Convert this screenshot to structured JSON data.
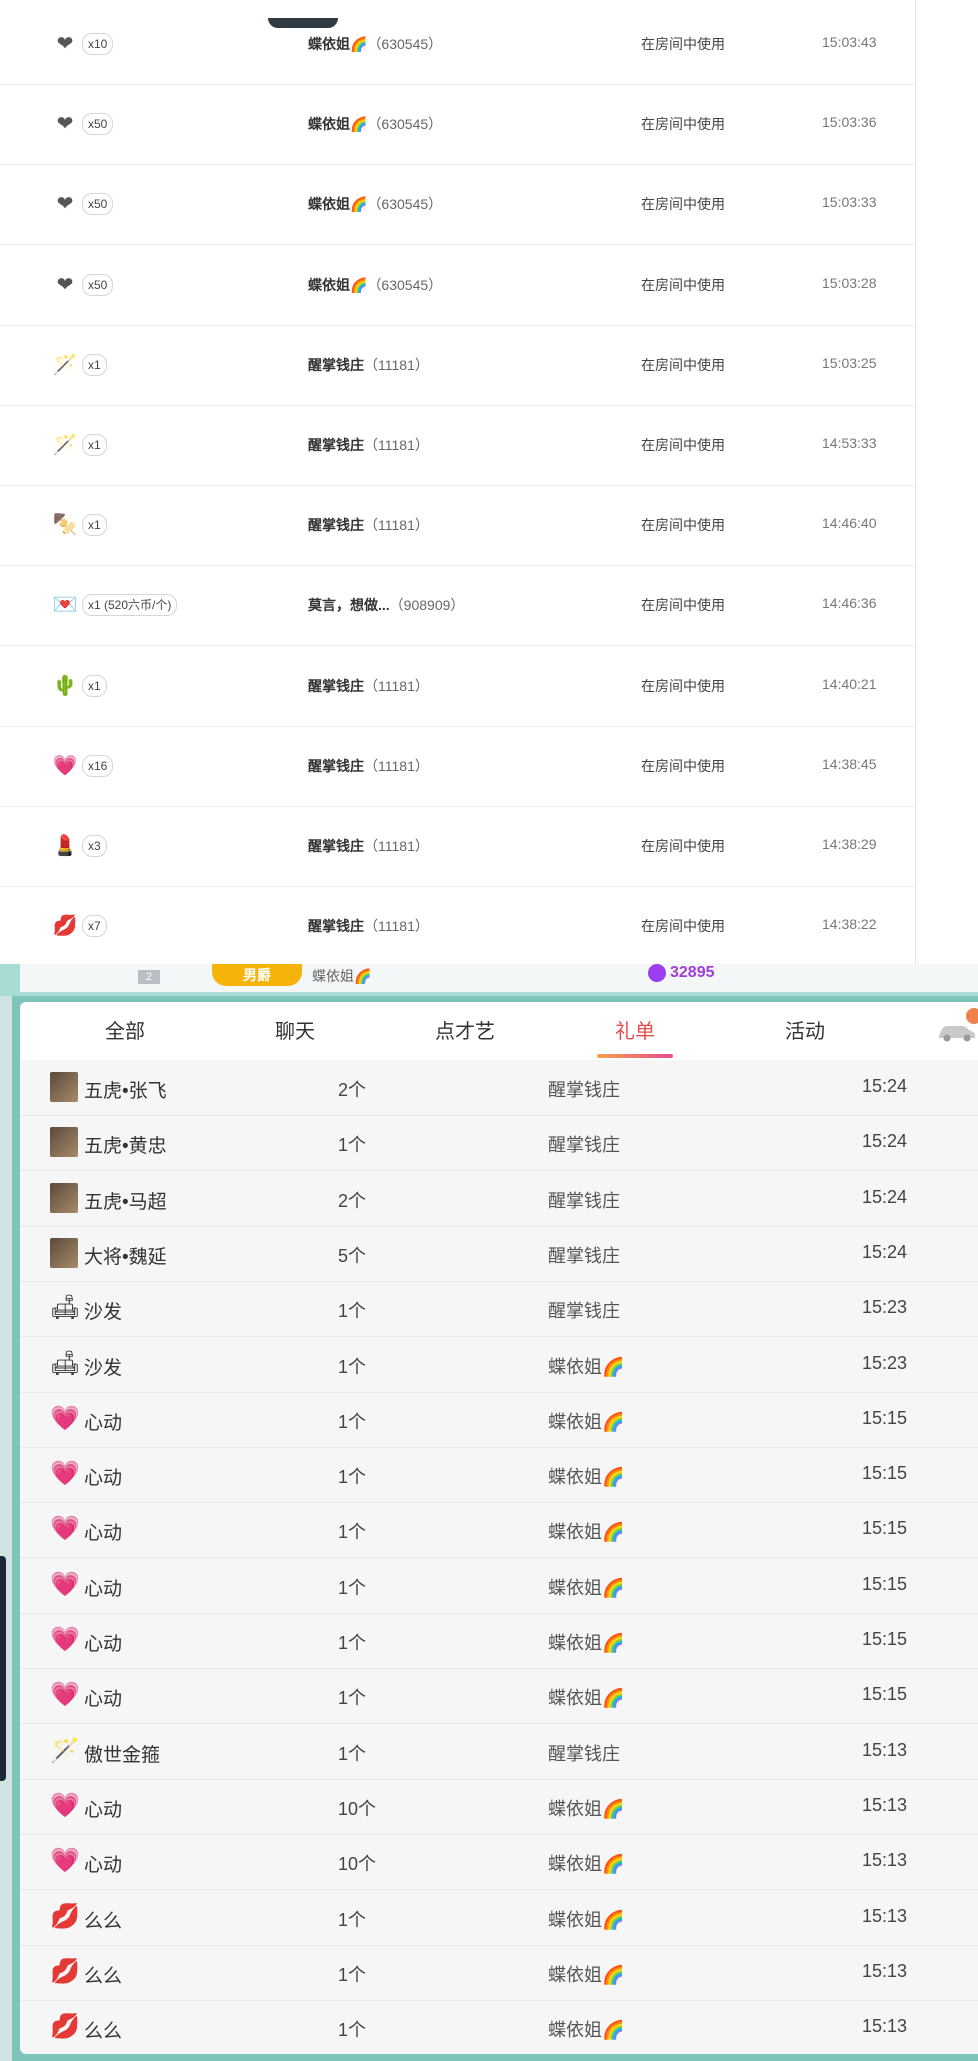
{
  "top_list": {
    "rows": [
      {
        "icon": "❤",
        "icon_name": "red-heart-icon",
        "qty": "x10",
        "user": "蝶依姐🌈",
        "uid": "（630545）",
        "action": "在房间中使用",
        "time": "15:03:43"
      },
      {
        "icon": "❤",
        "icon_name": "red-heart-icon",
        "qty": "x50",
        "user": "蝶依姐🌈",
        "uid": "（630545）",
        "action": "在房间中使用",
        "time": "15:03:36"
      },
      {
        "icon": "❤",
        "icon_name": "red-heart-icon",
        "qty": "x50",
        "user": "蝶依姐🌈",
        "uid": "（630545）",
        "action": "在房间中使用",
        "time": "15:03:33"
      },
      {
        "icon": "❤",
        "icon_name": "red-heart-icon",
        "qty": "x50",
        "user": "蝶依姐🌈",
        "uid": "（630545）",
        "action": "在房间中使用",
        "time": "15:03:28"
      },
      {
        "icon": "🪄",
        "icon_name": "golden-staff-icon",
        "qty": "x1",
        "user": "醒掌钱庄",
        "uid": "（11181）",
        "action": "在房间中使用",
        "time": "15:03:25"
      },
      {
        "icon": "🪄",
        "icon_name": "golden-staff-icon",
        "qty": "x1",
        "user": "醒掌钱庄",
        "uid": "（11181）",
        "action": "在房间中使用",
        "time": "14:53:33"
      },
      {
        "icon": "🍢",
        "icon_name": "skewer-icon",
        "qty": "x1",
        "user": "醒掌钱庄",
        "uid": "（11181）",
        "action": "在房间中使用",
        "time": "14:46:40"
      },
      {
        "icon": "💌",
        "icon_name": "love-letter-icon",
        "qty": "x1 (520六币/个)",
        "user": "莫言，想做...",
        "uid": "（908909）",
        "action": "在房间中使用",
        "time": "14:46:36"
      },
      {
        "icon": "🌵",
        "icon_name": "cactus-icon",
        "qty": "x1",
        "user": "醒掌钱庄",
        "uid": "（11181）",
        "action": "在房间中使用",
        "time": "14:40:21"
      },
      {
        "icon": "💗",
        "icon_name": "heartbeat-icon",
        "qty": "x16",
        "user": "醒掌钱庄",
        "uid": "（11181）",
        "action": "在房间中使用",
        "time": "14:38:45"
      },
      {
        "icon": "💄",
        "icon_name": "lipstick-icon",
        "qty": "x3",
        "user": "醒掌钱庄",
        "uid": "（11181）",
        "action": "在房间中使用",
        "time": "14:38:29"
      },
      {
        "icon": "💋",
        "icon_name": "kiss-lips-icon",
        "qty": "x7",
        "user": "醒掌钱庄",
        "uid": "（11181）",
        "action": "在房间中使用",
        "time": "14:38:22"
      }
    ]
  },
  "rank_strip": {
    "rank": "2",
    "badge": "男爵",
    "name": "蝶依姐🌈",
    "score": "32895"
  },
  "tabs": [
    {
      "label": "全部"
    },
    {
      "label": "聊天"
    },
    {
      "label": "点才艺"
    },
    {
      "label": "礼单",
      "active": true
    },
    {
      "label": "活动"
    }
  ],
  "gift_list": {
    "rows": [
      {
        "icon": "",
        "icon_name": "general-zhangfei-portrait-icon",
        "portrait": true,
        "name": "五虎•张飞",
        "qty": "2个",
        "sender": "醒掌钱庄",
        "time": "15:24"
      },
      {
        "icon": "",
        "icon_name": "general-huangzhong-portrait-icon",
        "portrait": true,
        "name": "五虎•黄忠",
        "qty": "1个",
        "sender": "醒掌钱庄",
        "time": "15:24"
      },
      {
        "icon": "",
        "icon_name": "general-machao-portrait-icon",
        "portrait": true,
        "name": "五虎•马超",
        "qty": "2个",
        "sender": "醒掌钱庄",
        "time": "15:24"
      },
      {
        "icon": "",
        "icon_name": "general-weiyan-portrait-icon",
        "portrait": true,
        "name": "大将•魏延",
        "qty": "5个",
        "sender": "醒掌钱庄",
        "time": "15:24"
      },
      {
        "icon": "🛋",
        "icon_name": "sofa-icon",
        "name": "沙发",
        "qty": "1个",
        "sender": "醒掌钱庄",
        "time": "15:23"
      },
      {
        "icon": "🛋",
        "icon_name": "sofa-icon",
        "name": "沙发",
        "qty": "1个",
        "sender": "蝶依姐🌈",
        "time": "15:23"
      },
      {
        "icon": "💗",
        "icon_name": "heartbeat-icon",
        "name": "心动",
        "qty": "1个",
        "sender": "蝶依姐🌈",
        "time": "15:15"
      },
      {
        "icon": "💗",
        "icon_name": "heartbeat-icon",
        "name": "心动",
        "qty": "1个",
        "sender": "蝶依姐🌈",
        "time": "15:15"
      },
      {
        "icon": "💗",
        "icon_name": "heartbeat-icon",
        "name": "心动",
        "qty": "1个",
        "sender": "蝶依姐🌈",
        "time": "15:15"
      },
      {
        "icon": "💗",
        "icon_name": "heartbeat-icon",
        "name": "心动",
        "qty": "1个",
        "sender": "蝶依姐🌈",
        "time": "15:15"
      },
      {
        "icon": "💗",
        "icon_name": "heartbeat-icon",
        "name": "心动",
        "qty": "1个",
        "sender": "蝶依姐🌈",
        "time": "15:15"
      },
      {
        "icon": "💗",
        "icon_name": "heartbeat-icon",
        "name": "心动",
        "qty": "1个",
        "sender": "蝶依姐🌈",
        "time": "15:15"
      },
      {
        "icon": "🪄",
        "icon_name": "golden-staff-icon",
        "name": "傲世金箍",
        "qty": "1个",
        "sender": "醒掌钱庄",
        "time": "15:13"
      },
      {
        "icon": "💗",
        "icon_name": "heartbeat-icon",
        "name": "心动",
        "qty": "10个",
        "sender": "蝶依姐🌈",
        "time": "15:13"
      },
      {
        "icon": "💗",
        "icon_name": "heartbeat-icon",
        "name": "心动",
        "qty": "10个",
        "sender": "蝶依姐🌈",
        "time": "15:13"
      },
      {
        "icon": "💋",
        "icon_name": "kiss-lips-icon",
        "name": "么么",
        "qty": "1个",
        "sender": "蝶依姐🌈",
        "time": "15:13"
      },
      {
        "icon": "💋",
        "icon_name": "kiss-lips-icon",
        "name": "么么",
        "qty": "1个",
        "sender": "蝶依姐🌈",
        "time": "15:13"
      },
      {
        "icon": "💋",
        "icon_name": "kiss-lips-icon",
        "name": "么么",
        "qty": "1个",
        "sender": "蝶依姐🌈",
        "time": "15:13"
      }
    ]
  },
  "colors": {
    "accent_tab": "#e84d4d",
    "frame_teal": "#7fc4ba",
    "badge_gold": "#f6b40a",
    "score_purple": "#a23ed6"
  }
}
